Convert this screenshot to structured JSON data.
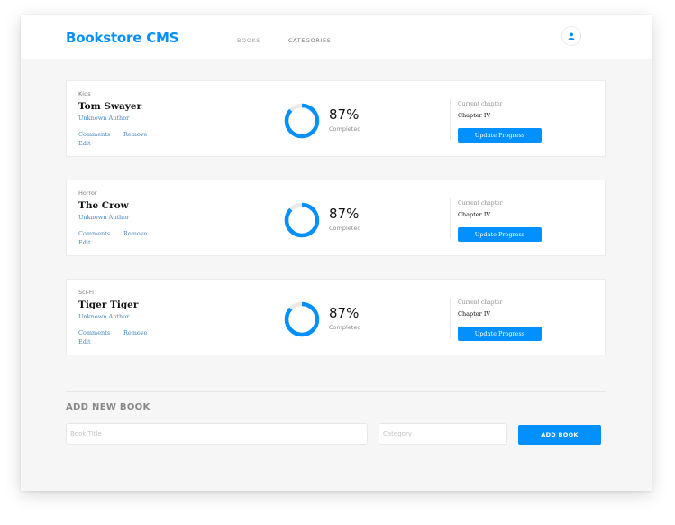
{
  "header": {
    "brand": "Bookstore CMS",
    "nav": [
      "BOOKS",
      "CATEGORIES"
    ],
    "avatar_icon": "user-icon"
  },
  "books": [
    {
      "genre": "Kids",
      "title": "Tom Swayer",
      "author": "Unknown Author",
      "actions": [
        "Comments",
        "Remove",
        "Edit"
      ],
      "progress": 0.87,
      "percent_label": "87%",
      "completed_label": "Completed",
      "chapter_label": "Current chapter",
      "chapter": "Chapter IV",
      "update_label": "Update Progress"
    },
    {
      "genre": "Horror",
      "title": "The Crow",
      "author": "Unknown Author",
      "actions": [
        "Comments",
        "Remove",
        "Edit"
      ],
      "progress": 0.87,
      "percent_label": "87%",
      "completed_label": "Completed",
      "chapter_label": "Current chapter",
      "chapter": "Chapter IV",
      "update_label": "Update Progress"
    },
    {
      "genre": "Sci-Fi",
      "title": "Tiger Tiger",
      "author": "Unknown Author",
      "actions": [
        "Comments",
        "Remove",
        "Edit"
      ],
      "progress": 0.87,
      "percent_label": "87%",
      "completed_label": "Completed",
      "chapter_label": "Current chapter",
      "chapter": "Chapter IV",
      "update_label": "Update Progress"
    }
  ],
  "form": {
    "title": "ADD NEW BOOK",
    "title_placeholder": "Book Title",
    "category_placeholder": "Category",
    "submit_label": "ADD BOOK"
  },
  "colors": {
    "accent": "#0290ff",
    "ring_track": "#e8e8e8",
    "link": "#4386bf"
  }
}
